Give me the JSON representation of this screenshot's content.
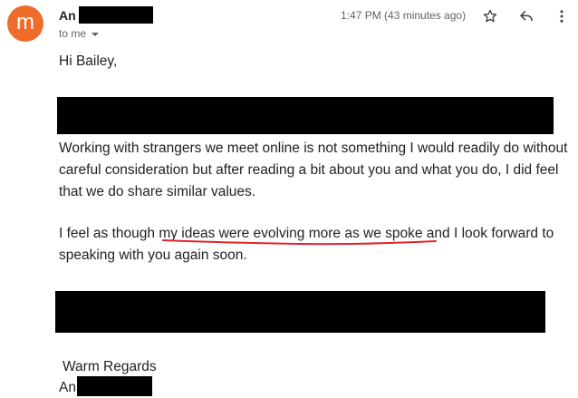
{
  "header": {
    "avatar_letter": "m",
    "avatar_color": "#ef6c2c",
    "sender_name_visible": "An",
    "recipient_label": "to me",
    "timestamp": "1:47 PM (43 minutes ago)",
    "icons": [
      "star-icon",
      "reply-icon",
      "more-vert-icon",
      "chevron-down-icon"
    ]
  },
  "body": {
    "greeting": "Hi Bailey,",
    "paragraph1": "Working with strangers we meet online is not something I would readily do without careful consideration but after reading a bit about you and what you do, I did feel that we do share similar values.",
    "paragraph2_before": "I feel as though ",
    "paragraph2_highlight": "my ideas were evolving more as we spoke",
    "paragraph2_after": " and I look forward to speaking with you again soon.",
    "highlight_color": "#e0242b",
    "closing": "Warm Regards",
    "signature_visible": "An"
  }
}
